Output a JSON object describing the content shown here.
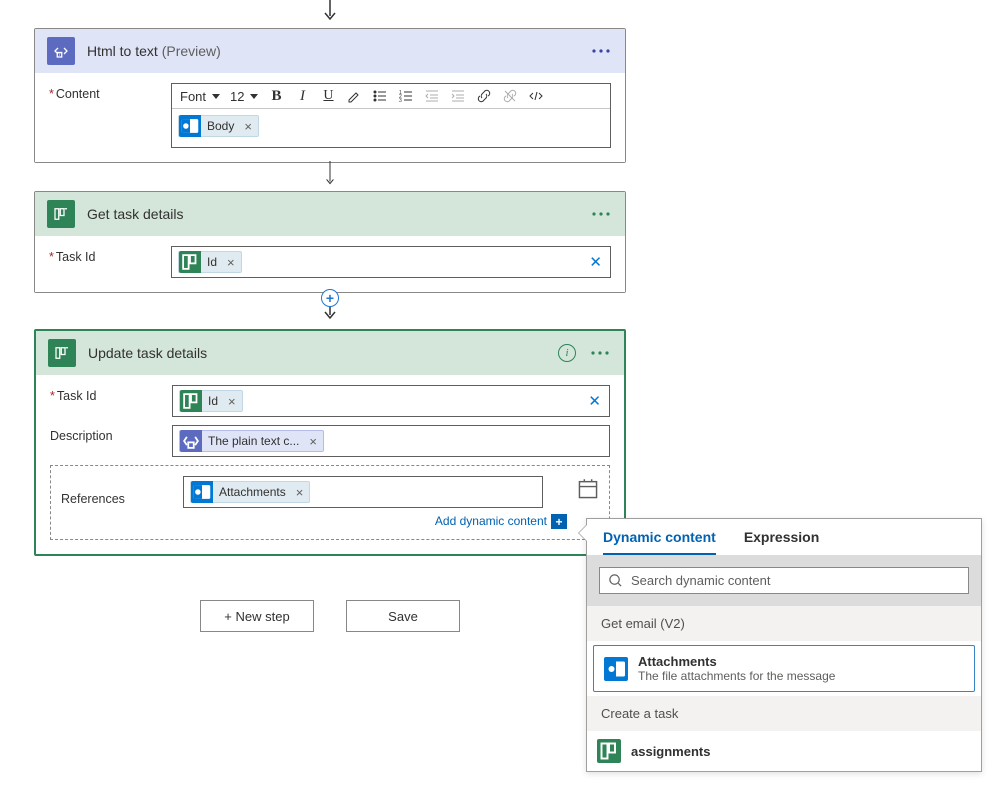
{
  "cards": {
    "html_to_text": {
      "title": "Html to text",
      "suffix": "(Preview)",
      "content_label": "Content",
      "font_select": "Font",
      "font_size": "12",
      "body_token": "Body"
    },
    "get_task": {
      "title": "Get task details",
      "taskid_label": "Task Id",
      "id_token": "Id"
    },
    "update_task": {
      "title": "Update task details",
      "taskid_label": "Task Id",
      "id_token": "Id",
      "description_label": "Description",
      "desc_token": "The plain text c...",
      "references_label": "References",
      "attachments_token": "Attachments",
      "add_dynamic": "Add dynamic content"
    }
  },
  "buttons": {
    "new_step": "+ New step",
    "save": "Save"
  },
  "dcpanel": {
    "tab_dynamic": "Dynamic content",
    "tab_expression": "Expression",
    "search_placeholder": "Search dynamic content",
    "group1": "Get email (V2)",
    "item1_title": "Attachments",
    "item1_sub": "The file attachments for the message",
    "group2": "Create a task",
    "item2_title": "assignments"
  }
}
